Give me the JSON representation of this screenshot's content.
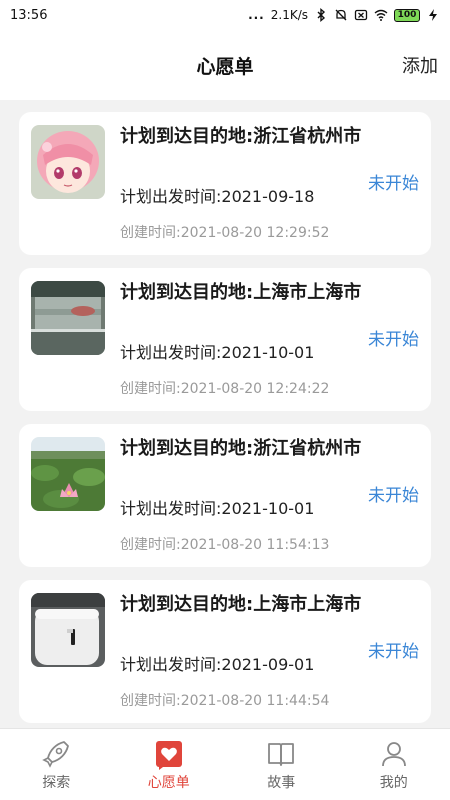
{
  "status_bar": {
    "time": "13:56",
    "dots": "...",
    "network_speed": "2.1K/s",
    "battery": "100",
    "icons": [
      "bluetooth-icon",
      "mute-icon",
      "sim-off-icon",
      "wifi-icon",
      "battery-icon",
      "charging-icon"
    ]
  },
  "header": {
    "title": "心愿单",
    "add_label": "添加"
  },
  "wishes": [
    {
      "title": "计划到达目的地:浙江省杭州市",
      "depart": "计划出发时间:2021-09-18",
      "created": "创建时间:2021-08-20 12:29:52",
      "status": "未开始",
      "thumb": "anime-girl"
    },
    {
      "title": "计划到达目的地:上海市上海市",
      "depart": "计划出发时间:2021-10-01",
      "created": "创建时间:2021-08-20 12:24:22",
      "status": "未开始",
      "thumb": "car-window"
    },
    {
      "title": "计划到达目的地:浙江省杭州市",
      "depart": "计划出发时间:2021-10-01",
      "created": "创建时间:2021-08-20 11:54:13",
      "status": "未开始",
      "thumb": "lotus"
    },
    {
      "title": "计划到达目的地:上海市上海市",
      "depart": "计划出发时间:2021-09-01",
      "created": "创建时间:2021-08-20 11:44:54",
      "status": "未开始",
      "thumb": "earbuds-case"
    }
  ],
  "bottom_nav": [
    {
      "label": "探索",
      "icon": "rocket-icon",
      "active": false
    },
    {
      "label": "心愿单",
      "icon": "heart-icon",
      "active": true
    },
    {
      "label": "故事",
      "icon": "book-icon",
      "active": false
    },
    {
      "label": "我的",
      "icon": "user-icon",
      "active": false
    }
  ],
  "colors": {
    "accent": "#e0453b",
    "status_blue": "#3a86d6",
    "background": "#f2f2f2"
  }
}
